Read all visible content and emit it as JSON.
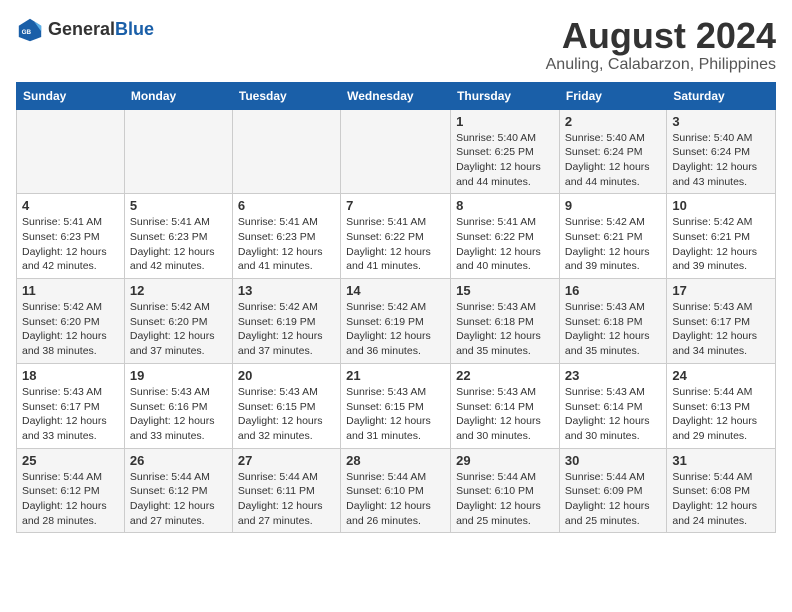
{
  "logo": {
    "text_general": "General",
    "text_blue": "Blue"
  },
  "title": {
    "month_year": "August 2024",
    "location": "Anuling, Calabarzon, Philippines"
  },
  "weekdays": [
    "Sunday",
    "Monday",
    "Tuesday",
    "Wednesday",
    "Thursday",
    "Friday",
    "Saturday"
  ],
  "weeks": [
    {
      "days": [
        {
          "num": "",
          "sunrise": "",
          "sunset": "",
          "daylight": ""
        },
        {
          "num": "",
          "sunrise": "",
          "sunset": "",
          "daylight": ""
        },
        {
          "num": "",
          "sunrise": "",
          "sunset": "",
          "daylight": ""
        },
        {
          "num": "",
          "sunrise": "",
          "sunset": "",
          "daylight": ""
        },
        {
          "num": "1",
          "sunrise": "Sunrise: 5:40 AM",
          "sunset": "Sunset: 6:25 PM",
          "daylight": "Daylight: 12 hours and 44 minutes."
        },
        {
          "num": "2",
          "sunrise": "Sunrise: 5:40 AM",
          "sunset": "Sunset: 6:24 PM",
          "daylight": "Daylight: 12 hours and 44 minutes."
        },
        {
          "num": "3",
          "sunrise": "Sunrise: 5:40 AM",
          "sunset": "Sunset: 6:24 PM",
          "daylight": "Daylight: 12 hours and 43 minutes."
        }
      ]
    },
    {
      "days": [
        {
          "num": "4",
          "sunrise": "Sunrise: 5:41 AM",
          "sunset": "Sunset: 6:23 PM",
          "daylight": "Daylight: 12 hours and 42 minutes."
        },
        {
          "num": "5",
          "sunrise": "Sunrise: 5:41 AM",
          "sunset": "Sunset: 6:23 PM",
          "daylight": "Daylight: 12 hours and 42 minutes."
        },
        {
          "num": "6",
          "sunrise": "Sunrise: 5:41 AM",
          "sunset": "Sunset: 6:23 PM",
          "daylight": "Daylight: 12 hours and 41 minutes."
        },
        {
          "num": "7",
          "sunrise": "Sunrise: 5:41 AM",
          "sunset": "Sunset: 6:22 PM",
          "daylight": "Daylight: 12 hours and 41 minutes."
        },
        {
          "num": "8",
          "sunrise": "Sunrise: 5:41 AM",
          "sunset": "Sunset: 6:22 PM",
          "daylight": "Daylight: 12 hours and 40 minutes."
        },
        {
          "num": "9",
          "sunrise": "Sunrise: 5:42 AM",
          "sunset": "Sunset: 6:21 PM",
          "daylight": "Daylight: 12 hours and 39 minutes."
        },
        {
          "num": "10",
          "sunrise": "Sunrise: 5:42 AM",
          "sunset": "Sunset: 6:21 PM",
          "daylight": "Daylight: 12 hours and 39 minutes."
        }
      ]
    },
    {
      "days": [
        {
          "num": "11",
          "sunrise": "Sunrise: 5:42 AM",
          "sunset": "Sunset: 6:20 PM",
          "daylight": "Daylight: 12 hours and 38 minutes."
        },
        {
          "num": "12",
          "sunrise": "Sunrise: 5:42 AM",
          "sunset": "Sunset: 6:20 PM",
          "daylight": "Daylight: 12 hours and 37 minutes."
        },
        {
          "num": "13",
          "sunrise": "Sunrise: 5:42 AM",
          "sunset": "Sunset: 6:19 PM",
          "daylight": "Daylight: 12 hours and 37 minutes."
        },
        {
          "num": "14",
          "sunrise": "Sunrise: 5:42 AM",
          "sunset": "Sunset: 6:19 PM",
          "daylight": "Daylight: 12 hours and 36 minutes."
        },
        {
          "num": "15",
          "sunrise": "Sunrise: 5:43 AM",
          "sunset": "Sunset: 6:18 PM",
          "daylight": "Daylight: 12 hours and 35 minutes."
        },
        {
          "num": "16",
          "sunrise": "Sunrise: 5:43 AM",
          "sunset": "Sunset: 6:18 PM",
          "daylight": "Daylight: 12 hours and 35 minutes."
        },
        {
          "num": "17",
          "sunrise": "Sunrise: 5:43 AM",
          "sunset": "Sunset: 6:17 PM",
          "daylight": "Daylight: 12 hours and 34 minutes."
        }
      ]
    },
    {
      "days": [
        {
          "num": "18",
          "sunrise": "Sunrise: 5:43 AM",
          "sunset": "Sunset: 6:17 PM",
          "daylight": "Daylight: 12 hours and 33 minutes."
        },
        {
          "num": "19",
          "sunrise": "Sunrise: 5:43 AM",
          "sunset": "Sunset: 6:16 PM",
          "daylight": "Daylight: 12 hours and 33 minutes."
        },
        {
          "num": "20",
          "sunrise": "Sunrise: 5:43 AM",
          "sunset": "Sunset: 6:15 PM",
          "daylight": "Daylight: 12 hours and 32 minutes."
        },
        {
          "num": "21",
          "sunrise": "Sunrise: 5:43 AM",
          "sunset": "Sunset: 6:15 PM",
          "daylight": "Daylight: 12 hours and 31 minutes."
        },
        {
          "num": "22",
          "sunrise": "Sunrise: 5:43 AM",
          "sunset": "Sunset: 6:14 PM",
          "daylight": "Daylight: 12 hours and 30 minutes."
        },
        {
          "num": "23",
          "sunrise": "Sunrise: 5:43 AM",
          "sunset": "Sunset: 6:14 PM",
          "daylight": "Daylight: 12 hours and 30 minutes."
        },
        {
          "num": "24",
          "sunrise": "Sunrise: 5:44 AM",
          "sunset": "Sunset: 6:13 PM",
          "daylight": "Daylight: 12 hours and 29 minutes."
        }
      ]
    },
    {
      "days": [
        {
          "num": "25",
          "sunrise": "Sunrise: 5:44 AM",
          "sunset": "Sunset: 6:12 PM",
          "daylight": "Daylight: 12 hours and 28 minutes."
        },
        {
          "num": "26",
          "sunrise": "Sunrise: 5:44 AM",
          "sunset": "Sunset: 6:12 PM",
          "daylight": "Daylight: 12 hours and 27 minutes."
        },
        {
          "num": "27",
          "sunrise": "Sunrise: 5:44 AM",
          "sunset": "Sunset: 6:11 PM",
          "daylight": "Daylight: 12 hours and 27 minutes."
        },
        {
          "num": "28",
          "sunrise": "Sunrise: 5:44 AM",
          "sunset": "Sunset: 6:10 PM",
          "daylight": "Daylight: 12 hours and 26 minutes."
        },
        {
          "num": "29",
          "sunrise": "Sunrise: 5:44 AM",
          "sunset": "Sunset: 6:10 PM",
          "daylight": "Daylight: 12 hours and 25 minutes."
        },
        {
          "num": "30",
          "sunrise": "Sunrise: 5:44 AM",
          "sunset": "Sunset: 6:09 PM",
          "daylight": "Daylight: 12 hours and 25 minutes."
        },
        {
          "num": "31",
          "sunrise": "Sunrise: 5:44 AM",
          "sunset": "Sunset: 6:08 PM",
          "daylight": "Daylight: 12 hours and 24 minutes."
        }
      ]
    }
  ]
}
